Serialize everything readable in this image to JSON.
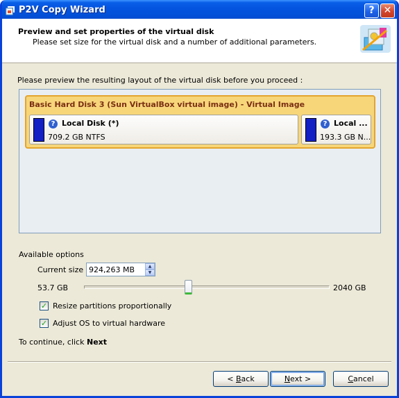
{
  "window": {
    "title": "P2V Copy Wizard",
    "help_glyph": "?",
    "close_glyph": "✕"
  },
  "header": {
    "title": "Preview and set properties of the virtual disk",
    "subtitle": "Please set size for the virtual disk and a number of additional parameters."
  },
  "instruction": "Please preview the resulting layout of the virtual disk before you proceed :",
  "disk": {
    "label": "Basic Hard Disk 3 (Sun VirtualBox virtual image) - Virtual Image",
    "partitions": [
      {
        "name": "Local Disk (*)",
        "desc": "709.2 GB NTFS",
        "color": "#1320c4"
      },
      {
        "name": "Local ...",
        "desc": "193.3 GB N...",
        "color": "#1320c4"
      }
    ]
  },
  "options": {
    "heading": "Available options",
    "current_size_label": "Current size is",
    "current_size_value": "924,263 MB",
    "slider_min_label": "53.7 GB",
    "slider_max_label": "2040 GB",
    "slider_fraction": 0.44,
    "resize_label": "Resize partitions proportionally",
    "resize_checked": true,
    "adjust_label": "Adjust OS to virtual hardware",
    "adjust_checked": true
  },
  "continue_text": "To continue, click",
  "continue_bold": "Next",
  "buttons": {
    "back": {
      "prefix": "< ",
      "mnemonic": "B",
      "rest": "ack"
    },
    "next": {
      "mnemonic": "N",
      "rest": "ext >"
    },
    "cancel": {
      "mnemonic": "C",
      "rest": "ancel"
    }
  },
  "colors": {
    "titlebar": "#0454e0",
    "disk_fill": "#f7d67a",
    "disk_border": "#e3a52e",
    "accent": "#003c74"
  }
}
